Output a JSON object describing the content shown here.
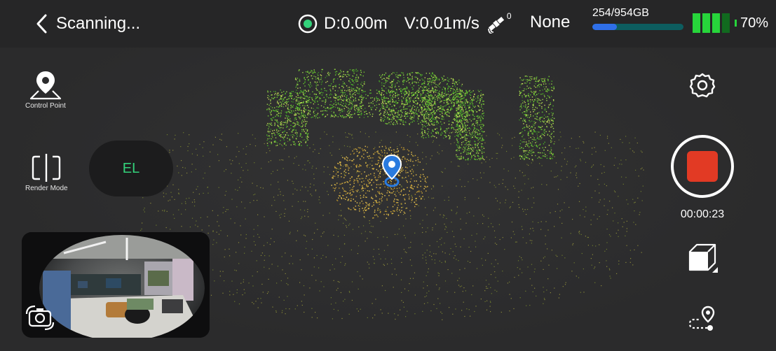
{
  "header": {
    "title": "Scanning...",
    "distance": "D:0.00m",
    "velocity": "V:0.01m/s",
    "satellite_count": "0",
    "gnss_status": "None",
    "storage": {
      "text": "254/954GB",
      "used_fraction": 0.266
    },
    "battery": {
      "text": "70%",
      "level_fraction": 0.7
    }
  },
  "left_tools": {
    "control_point_label": "Control Point",
    "render_mode_label": "Render Mode",
    "el_label": "EL"
  },
  "right_tools": {
    "timer": "00:00:23"
  },
  "colors": {
    "accent_green": "#33d17a",
    "record_red": "#e23a24",
    "storage_fill": "#2f6fe8",
    "storage_track": "#0d5d5f",
    "battery_green": "#27d53b",
    "location_pin": "#2a7bdf"
  },
  "icons": [
    "back-chevron-icon",
    "target-icon",
    "satellite-icon",
    "control-point-icon",
    "render-mode-icon",
    "camera-switch-icon",
    "settings-icon",
    "record-stop-icon",
    "cube-view-icon",
    "route-icon",
    "location-pin-icon"
  ]
}
